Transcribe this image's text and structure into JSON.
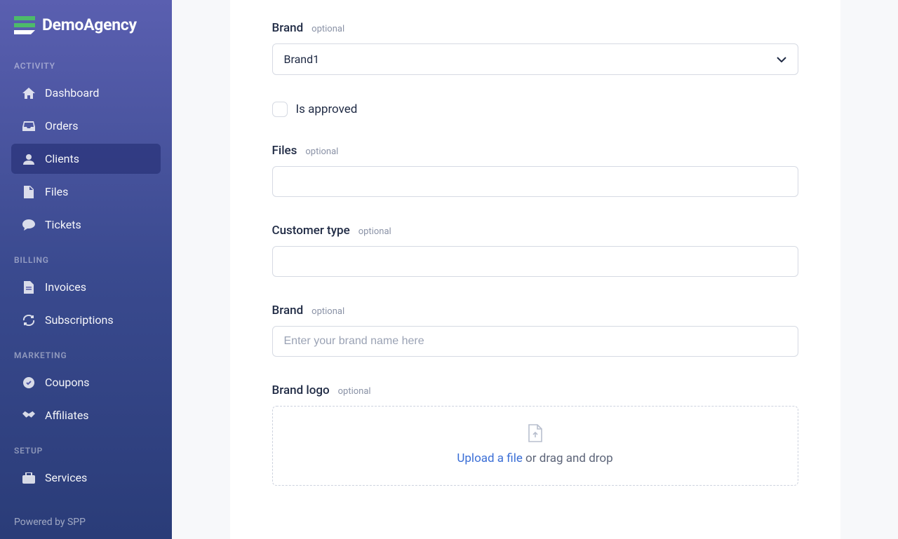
{
  "app": {
    "name": "DemoAgency"
  },
  "sidebar": {
    "sections": [
      {
        "label": "ACTIVITY",
        "items": [
          {
            "icon": "home-icon",
            "label": "Dashboard",
            "active": false
          },
          {
            "icon": "inbox-icon",
            "label": "Orders",
            "active": false
          },
          {
            "icon": "user-icon",
            "label": "Clients",
            "active": true
          },
          {
            "icon": "file-icon",
            "label": "Files",
            "active": false
          },
          {
            "icon": "chat-icon",
            "label": "Tickets",
            "active": false
          }
        ]
      },
      {
        "label": "BILLING",
        "items": [
          {
            "icon": "invoice-icon",
            "label": "Invoices",
            "active": false
          },
          {
            "icon": "refresh-icon",
            "label": "Subscriptions",
            "active": false
          }
        ]
      },
      {
        "label": "MARKETING",
        "items": [
          {
            "icon": "tag-icon",
            "label": "Coupons",
            "active": false
          },
          {
            "icon": "handshake-icon",
            "label": "Affiliates",
            "active": false
          }
        ]
      },
      {
        "label": "SETUP",
        "items": [
          {
            "icon": "briefcase-icon",
            "label": "Services",
            "active": false
          }
        ]
      }
    ],
    "footer": "Powered by SPP"
  },
  "form": {
    "brand_select": {
      "label": "Brand",
      "optional": "optional",
      "value": "Brand1"
    },
    "is_approved": {
      "label": "Is approved",
      "checked": false
    },
    "files": {
      "label": "Files",
      "optional": "optional"
    },
    "customer_type": {
      "label": "Customer type",
      "optional": "optional",
      "value": ""
    },
    "brand_input": {
      "label": "Brand",
      "optional": "optional",
      "placeholder": "Enter your brand name here",
      "value": ""
    },
    "brand_logo": {
      "label": "Brand logo",
      "optional": "optional",
      "upload_link": "Upload a file",
      "upload_rest": " or drag and drop"
    }
  }
}
